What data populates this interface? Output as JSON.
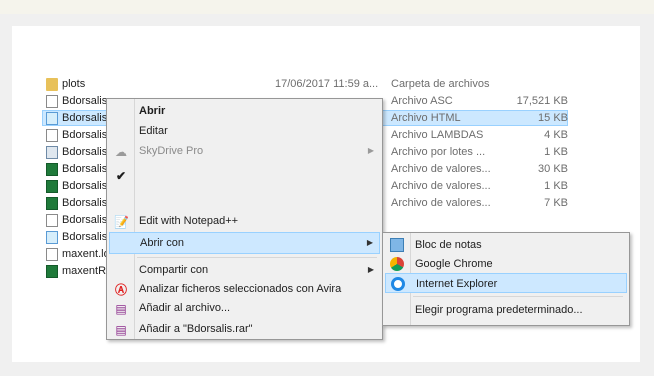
{
  "files": [
    {
      "name": "plots",
      "date": "17/06/2017 11:59 a...",
      "type": "Carpeta de archivos",
      "size": "",
      "icon": "folder-icon"
    },
    {
      "name": "Bdorsalis",
      "date": "",
      "type": "Archivo ASC",
      "size": "17,521 KB",
      "icon": "document-icon"
    },
    {
      "name": "Bdorsalis",
      "date": "",
      "type": "Archivo HTML",
      "size": "15 KB",
      "icon": "html-file-icon"
    },
    {
      "name": "Bdorsalis",
      "date": "",
      "type": "Archivo LAMBDAS",
      "size": "4 KB",
      "icon": "document-icon"
    },
    {
      "name": "Bdorsalis",
      "date": "",
      "type": "Archivo por lotes ...",
      "size": "1 KB",
      "icon": "batch-file-icon"
    },
    {
      "name": "Bdorsalis",
      "date": "",
      "type": "Archivo de valores...",
      "size": "30 KB",
      "icon": "csv-file-icon"
    },
    {
      "name": "Bdorsalis",
      "date": "",
      "type": "Archivo de valores...",
      "size": "1 KB",
      "icon": "csv-file-icon"
    },
    {
      "name": "Bdorsalis",
      "date": "",
      "type": "Archivo de valores...",
      "size": "7 KB",
      "icon": "csv-file-icon"
    },
    {
      "name": "Bdorsalis",
      "date": "",
      "type": "",
      "size": "",
      "icon": "document-icon"
    },
    {
      "name": "Bdorsalis",
      "date": "",
      "type": "",
      "size": "",
      "icon": "html-file-icon"
    },
    {
      "name": "maxent.lo",
      "date": "",
      "type": "",
      "size": "",
      "icon": "document-icon"
    },
    {
      "name": "maxentRe",
      "date": "",
      "type": "",
      "size": "",
      "icon": "excel-file-icon"
    }
  ],
  "context_menu": {
    "open": "Abrir",
    "edit": "Editar",
    "skydrive": "SkyDrive Pro",
    "notepadpp": "Edit with Notepad++",
    "open_with": "Abrir con",
    "share_with": "Compartir con",
    "avira": "Analizar ficheros seleccionados con Avira",
    "add_archive": "Añadir al archivo...",
    "add_rar": "Añadir a \"Bdorsalis.rar\""
  },
  "open_with_menu": {
    "notepad": "Bloc de notas",
    "chrome": "Google Chrome",
    "ie": "Internet Explorer",
    "choose_default": "Elegir programa predeterminado..."
  },
  "colors": {
    "selection": "#cce8ff",
    "menu_bg": "#f0f0f0",
    "hover_border": "#99d1ff"
  }
}
